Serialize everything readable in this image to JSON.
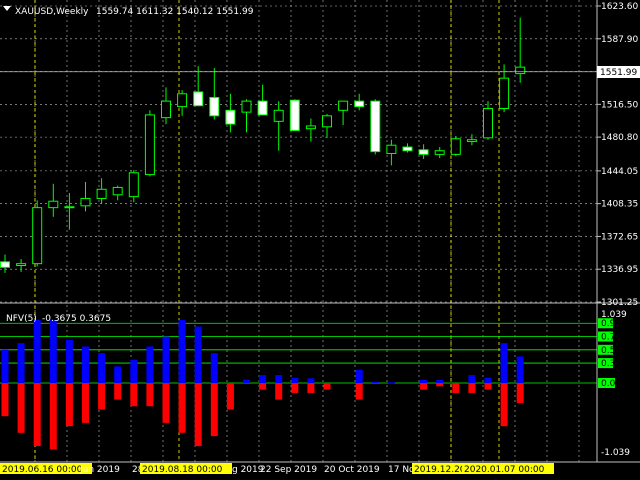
{
  "main_header": {
    "symbol_timeframe": "XAUUSD,Weekly",
    "ohlc": "1559.74 1611.32 1540.12 1551.99"
  },
  "indicator_header": {
    "name": "NFV(5)",
    "values": "-0.3675 0.3675"
  },
  "current_price_label": "1551.99",
  "level_labels": [
    "0.9",
    "0.7",
    "0.5",
    "0.3",
    "0.00"
  ],
  "highlighted_dates": [
    "2019.06.16 00:00",
    "2019.08.18 00:00",
    "2019.12.20",
    "2020.01.07 00:00"
  ],
  "colors": {
    "background": "#000000",
    "grid": "#c0c0c0",
    "bull_candle": "#00ff00",
    "bear_candle_fill": "#ffffff",
    "hist_positive": "#0000ff",
    "hist_negative": "#ff0000",
    "levels": "#00ff00",
    "date_tag": "#ffff00"
  },
  "chart_data": [
    {
      "type": "candlestick",
      "title": "XAUUSD,Weekly",
      "y_ticks": [
        "1623.60",
        "1587.90",
        "1552.20",
        "1516.50",
        "1480.80",
        "1444.05",
        "1408.35",
        "1372.65",
        "1336.95",
        "1301.25"
      ],
      "x_ticks": [
        "2019.06.16 00:00",
        "Jun 2019",
        "28",
        "2019.08.18 00:00",
        "g 2019",
        "22 Sep 2019",
        "20 Oct 2019",
        "17 No",
        "2019.12.20",
        "2020.01.07 00:00"
      ],
      "ylim": [
        1301.25,
        1623.6
      ],
      "candles": [
        {
          "o": 1345,
          "h": 1353,
          "l": 1333,
          "c": 1339
        },
        {
          "o": 1341,
          "h": 1348,
          "l": 1334,
          "c": 1343
        },
        {
          "o": 1343,
          "h": 1412,
          "l": 1340,
          "c": 1404
        },
        {
          "o": 1404,
          "h": 1430,
          "l": 1394,
          "c": 1411
        },
        {
          "o": 1404,
          "h": 1420,
          "l": 1380,
          "c": 1405
        },
        {
          "o": 1406,
          "h": 1432,
          "l": 1400,
          "c": 1414
        },
        {
          "o": 1414,
          "h": 1436,
          "l": 1408,
          "c": 1424
        },
        {
          "o": 1418,
          "h": 1428,
          "l": 1412,
          "c": 1426
        },
        {
          "o": 1416,
          "h": 1445,
          "l": 1410,
          "c": 1442
        },
        {
          "o": 1440,
          "h": 1510,
          "l": 1438,
          "c": 1505
        },
        {
          "o": 1502,
          "h": 1535,
          "l": 1495,
          "c": 1520
        },
        {
          "o": 1514,
          "h": 1532,
          "l": 1504,
          "c": 1528
        },
        {
          "o": 1530,
          "h": 1558,
          "l": 1522,
          "c": 1515
        },
        {
          "o": 1524,
          "h": 1556,
          "l": 1500,
          "c": 1504
        },
        {
          "o": 1510,
          "h": 1528,
          "l": 1486,
          "c": 1495
        },
        {
          "o": 1508,
          "h": 1522,
          "l": 1486,
          "c": 1520
        },
        {
          "o": 1520,
          "h": 1538,
          "l": 1505,
          "c": 1505
        },
        {
          "o": 1498,
          "h": 1520,
          "l": 1466,
          "c": 1510
        },
        {
          "o": 1521,
          "h": 1522,
          "l": 1488,
          "c": 1488
        },
        {
          "o": 1490,
          "h": 1501,
          "l": 1476,
          "c": 1493
        },
        {
          "o": 1492,
          "h": 1506,
          "l": 1480,
          "c": 1504
        },
        {
          "o": 1510,
          "h": 1519,
          "l": 1494,
          "c": 1520
        },
        {
          "o": 1520,
          "h": 1528,
          "l": 1510,
          "c": 1514
        },
        {
          "o": 1520,
          "h": 1522,
          "l": 1462,
          "c": 1465
        },
        {
          "o": 1463,
          "h": 1478,
          "l": 1450,
          "c": 1472
        },
        {
          "o": 1470,
          "h": 1474,
          "l": 1464,
          "c": 1466
        },
        {
          "o": 1467,
          "h": 1473,
          "l": 1457,
          "c": 1462
        },
        {
          "o": 1462,
          "h": 1470,
          "l": 1458,
          "c": 1466
        },
        {
          "o": 1462,
          "h": 1482,
          "l": 1460,
          "c": 1479
        },
        {
          "o": 1476,
          "h": 1484,
          "l": 1472,
          "c": 1478
        },
        {
          "o": 1480,
          "h": 1520,
          "l": 1478,
          "c": 1512
        },
        {
          "o": 1512,
          "h": 1560,
          "l": 1508,
          "c": 1545
        },
        {
          "o": 1550,
          "h": 1611,
          "l": 1540,
          "c": 1557
        }
      ],
      "current_price": 1551.99
    },
    {
      "type": "bar",
      "title": "NFV(5)",
      "y_ticks": [
        "1.039",
        "0.9",
        "0.7",
        "0.5",
        "0.3",
        "0.00",
        "-1.039"
      ],
      "ylim": [
        -1.039,
        1.039
      ],
      "levels": [
        0.9,
        0.7,
        0.5,
        0.3,
        0.0
      ],
      "series": [
        {
          "values": [
            0.5,
            0.6,
            0.95,
            0.95,
            0.65,
            0.55,
            0.45,
            0.25,
            0.35,
            0.55,
            0.7,
            0.95,
            0.85,
            0.45,
            0.0,
            0.05,
            0.12,
            0.12,
            0.08,
            0.07,
            0.0,
            0.0,
            0.2,
            0.02,
            0.01,
            0.0,
            0.05,
            0.05,
            0.0,
            0.12,
            0.08,
            0.6,
            0.4
          ]
        },
        {
          "values": [
            -0.5,
            -0.75,
            -0.95,
            -1.0,
            -0.65,
            -0.6,
            -0.4,
            -0.25,
            -0.35,
            -0.35,
            -0.6,
            -0.75,
            -0.95,
            -0.8,
            -0.4,
            0.0,
            -0.1,
            -0.25,
            -0.15,
            -0.15,
            -0.1,
            0.0,
            -0.25,
            0.0,
            0.0,
            0.0,
            -0.1,
            -0.05,
            -0.15,
            -0.15,
            -0.1,
            -0.65,
            -0.3
          ]
        }
      ]
    }
  ]
}
